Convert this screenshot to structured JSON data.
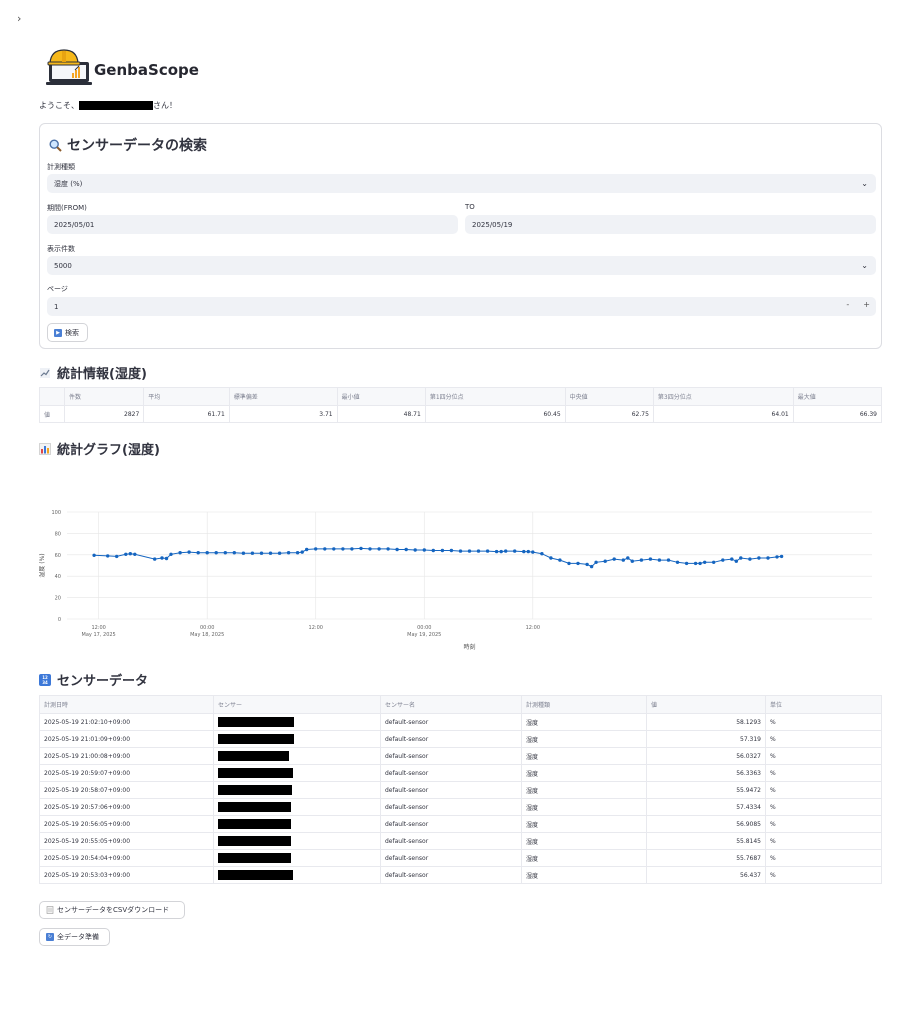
{
  "app": {
    "brand": "GenbaScope",
    "welcome_prefix": "ようこそ、",
    "welcome_suffix": "さん！"
  },
  "search": {
    "title": "センサーデータの検索",
    "measure_label": "計測種類",
    "measure_value": "湿度 (%)",
    "from_label": "期間(FROM)",
    "from_value": "2025/05/01",
    "to_label": "TO",
    "to_value": "2025/05/19",
    "count_label": "表示件数",
    "count_value": "5000",
    "page_label": "ページ",
    "page_value": "1",
    "button": "検索"
  },
  "stats": {
    "title": "統計情報(湿度)",
    "headers": [
      "",
      "件数",
      "平均",
      "標準偏差",
      "最小値",
      "第1四分位点",
      "中央値",
      "第3四分位点",
      "最大値"
    ],
    "row": [
      "値",
      "2827",
      "61.71",
      "3.71",
      "48.71",
      "60.45",
      "62.75",
      "64.01",
      "66.39"
    ],
    "icon": "chart-icon"
  },
  "graph": {
    "title": "統計グラフ(湿度)",
    "icon": "bar-chart-icon"
  },
  "chart_data": {
    "type": "line",
    "title": "",
    "xlabel": "時刻",
    "ylabel": "湿度 (%)",
    "ylim": [
      0,
      100
    ],
    "yticks": [
      "0",
      "20",
      "40",
      "60",
      "80",
      "100"
    ],
    "xticks": [
      {
        "label": "12:00",
        "sub": "May 17, 2025",
        "t": 0.0
      },
      {
        "label": "00:00",
        "sub": "May 18, 2025",
        "t": 12.0
      },
      {
        "label": "12:00",
        "sub": "",
        "t": 24.0
      },
      {
        "label": "00:00",
        "sub": "May 19, 2025",
        "t": 36.0
      },
      {
        "label": "12:00",
        "sub": "",
        "t": 48.0
      }
    ],
    "color": "#1565c0",
    "series": [
      {
        "x_hours_from_start": [
          -0.5,
          1,
          2,
          3,
          3.5,
          4,
          6.2,
          7,
          7.5,
          8,
          9,
          10,
          11,
          12,
          13,
          14,
          15,
          16,
          17,
          18,
          19,
          20,
          21,
          22,
          22.5,
          23,
          24,
          25,
          26,
          27,
          28,
          29,
          30,
          31,
          32,
          33,
          34,
          35,
          36,
          37,
          38,
          39,
          40,
          41,
          42,
          43,
          44,
          44.5,
          45,
          46,
          47,
          47.5,
          48,
          49,
          50,
          51,
          52,
          53,
          54,
          54.5,
          55,
          56,
          57,
          58,
          58.5,
          59,
          60,
          61,
          62,
          63,
          64,
          65,
          66,
          66.5,
          67,
          68,
          69,
          70,
          70.5,
          71,
          72,
          73,
          74,
          75,
          75.5
        ],
        "y": [
          59.5,
          59,
          58.5,
          60.5,
          61,
          60.5,
          56,
          57,
          56.5,
          60.5,
          62,
          62.5,
          62,
          62,
          62,
          62,
          62,
          61.5,
          61.5,
          61.5,
          61.5,
          61.5,
          62,
          62,
          62.5,
          65,
          65.5,
          65.5,
          65.5,
          65.5,
          65.5,
          66,
          65.5,
          65.5,
          65.5,
          65,
          65,
          64.5,
          64.5,
          64,
          64,
          64,
          63.5,
          63.5,
          63.5,
          63.5,
          63,
          63,
          63.5,
          63.5,
          63,
          63,
          62.5,
          61,
          57,
          55,
          52,
          52,
          51,
          49,
          53,
          54,
          56,
          55,
          57,
          54,
          55,
          56,
          55,
          55,
          53,
          52,
          52,
          52,
          53,
          53,
          55,
          56,
          54,
          57,
          56,
          57,
          57,
          58,
          58.5
        ]
      }
    ]
  },
  "sensor": {
    "title": "センサーデータ",
    "headers": [
      "計測日時",
      "センサー",
      "センサー名",
      "計測種類",
      "値",
      "単位"
    ],
    "rows": [
      [
        "2025-05-19 21:02:10+09:00",
        "default-sensor",
        "湿度",
        "58.1293",
        "%"
      ],
      [
        "2025-05-19 21:01:09+09:00",
        "default-sensor",
        "湿度",
        "57.319",
        "%"
      ],
      [
        "2025-05-19 21:00:08+09:00",
        "default-sensor",
        "湿度",
        "56.0327",
        "%"
      ],
      [
        "2025-05-19 20:59:07+09:00",
        "default-sensor",
        "湿度",
        "56.3363",
        "%"
      ],
      [
        "2025-05-19 20:58:07+09:00",
        "default-sensor",
        "湿度",
        "55.9472",
        "%"
      ],
      [
        "2025-05-19 20:57:06+09:00",
        "default-sensor",
        "湿度",
        "57.4334",
        "%"
      ],
      [
        "2025-05-19 20:56:05+09:00",
        "default-sensor",
        "湿度",
        "56.9085",
        "%"
      ],
      [
        "2025-05-19 20:55:05+09:00",
        "default-sensor",
        "湿度",
        "55.8145",
        "%"
      ],
      [
        "2025-05-19 20:54:04+09:00",
        "default-sensor",
        "湿度",
        "55.7687",
        "%"
      ],
      [
        "2025-05-19 20:53:03+09:00",
        "default-sensor",
        "湿度",
        "56.437",
        "%"
      ]
    ],
    "icon": "numbers-icon"
  },
  "buttons": {
    "csv": "センサーデータをCSVダウンロード",
    "prepare": "全データ準備"
  }
}
